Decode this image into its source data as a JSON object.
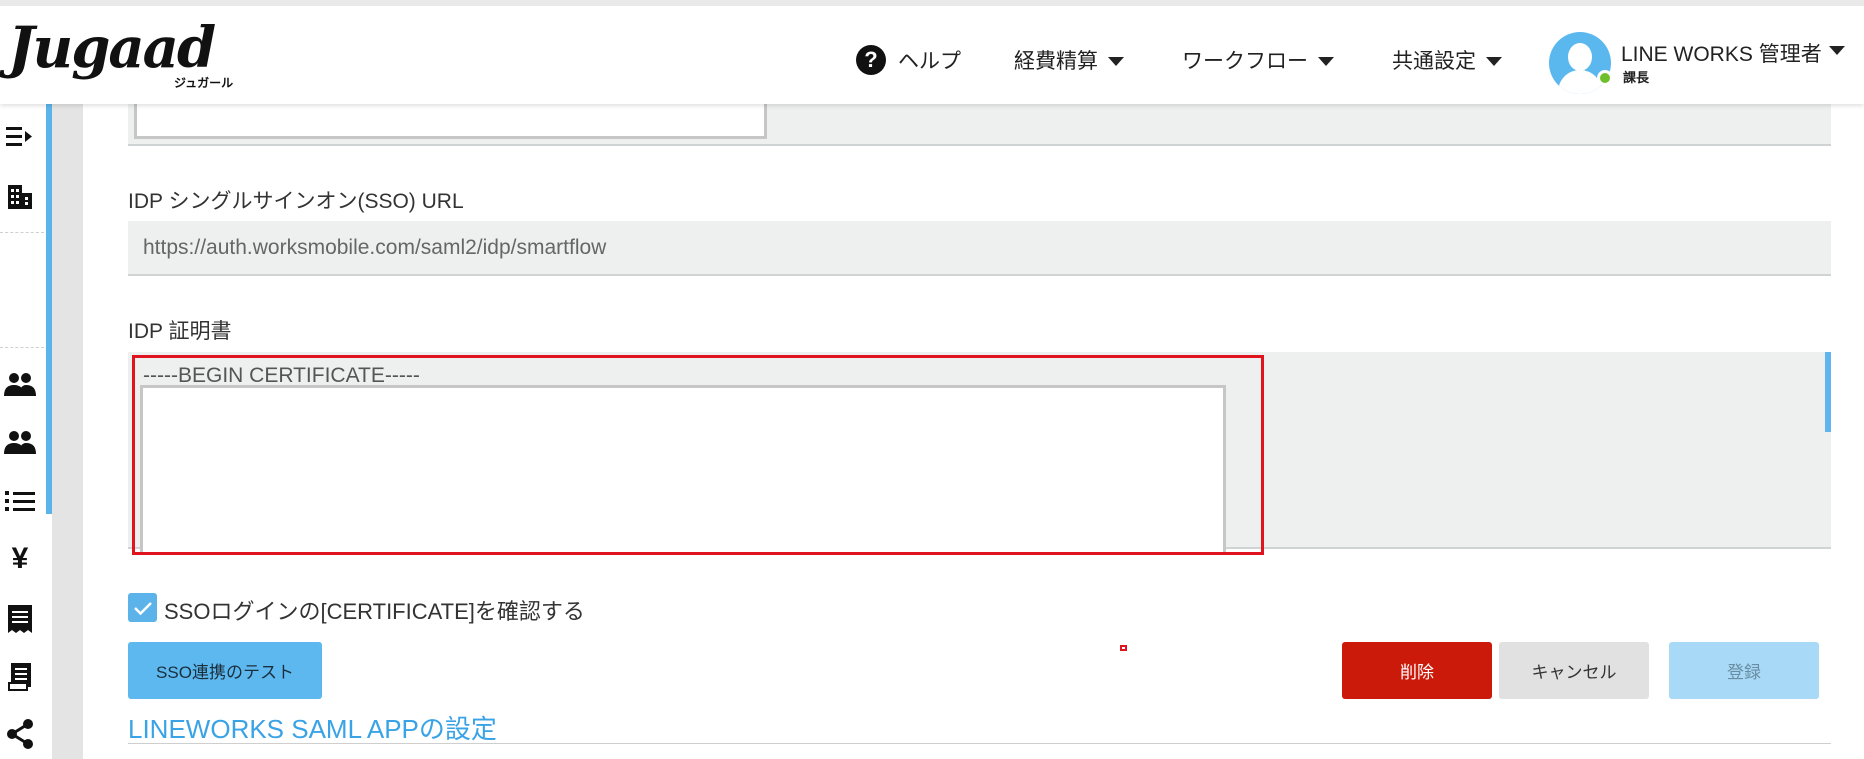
{
  "header": {
    "logo_text": "Jugaad",
    "logo_sub": "ジュガール",
    "nav": {
      "help": "ヘルプ",
      "expense": "経費精算",
      "workflow": "ワークフロー",
      "common_settings": "共通設定"
    },
    "user": {
      "name": "LINE WORKS 管理者",
      "role": "課長"
    }
  },
  "sidebar": {
    "icons": [
      "collapse-menu-icon",
      "building-icon",
      "users-icon",
      "users-icon",
      "list-icon",
      "yen-icon",
      "receipt-icon",
      "document-icon",
      "share-icon"
    ]
  },
  "form": {
    "idp_sso_url_label": "IDP シングルサインオン(SSO) URL",
    "idp_sso_url_value": "https://auth.worksmobile.com/saml2/idp/smartflow",
    "idp_cert_label": "IDP 証明書",
    "idp_cert_value": "-----BEGIN CERTIFICATE-----",
    "confirm_checkbox_label": "SSOログインの[CERTIFICATE]を確認する",
    "confirm_checked": true
  },
  "buttons": {
    "sso_test": "SSO連携のテスト",
    "delete": "削除",
    "cancel": "キャンセル",
    "register": "登録"
  },
  "section": {
    "title": "LINEWORKS SAML APPの設定"
  },
  "colors": {
    "accent": "#5cb3ea",
    "delete": "#cc1a0a",
    "highlight": "#e0141e"
  }
}
